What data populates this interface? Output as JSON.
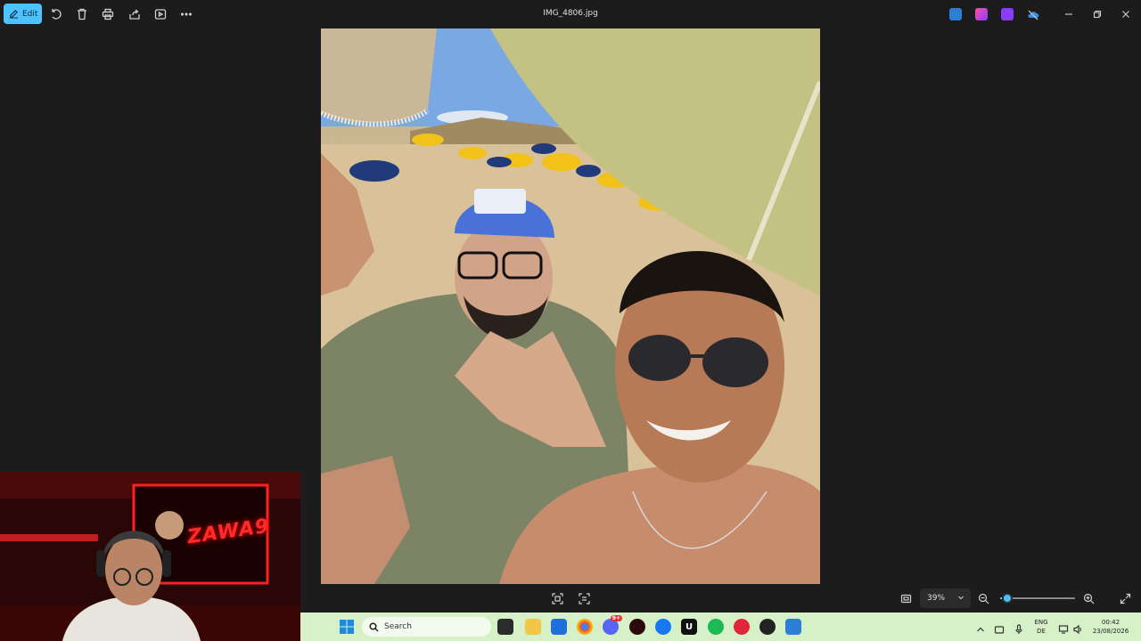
{
  "titlebar": {
    "edit_label": "Edit",
    "file_name": "IMG_4806.jpg",
    "icons": [
      "rotate-icon",
      "delete-icon",
      "print-icon",
      "share-icon",
      "slideshow-icon",
      "more-icon"
    ]
  },
  "bottombar": {
    "zoom_value": "39%",
    "zoom_fraction": 0.39
  },
  "webcam": {
    "banner_text": "ZAWA9"
  },
  "taskbar": {
    "search_placeholder": "Search",
    "language_line1": "ENG",
    "language_line2": "DE",
    "time": "00:42",
    "date": "23/08/2026",
    "discord_badge": "9+",
    "u_app_letter": "U"
  },
  "colors": {
    "accent": "#4cc2ff",
    "taskbar_bg": "#d6f0c8",
    "window_bg": "#1c1c1c"
  }
}
